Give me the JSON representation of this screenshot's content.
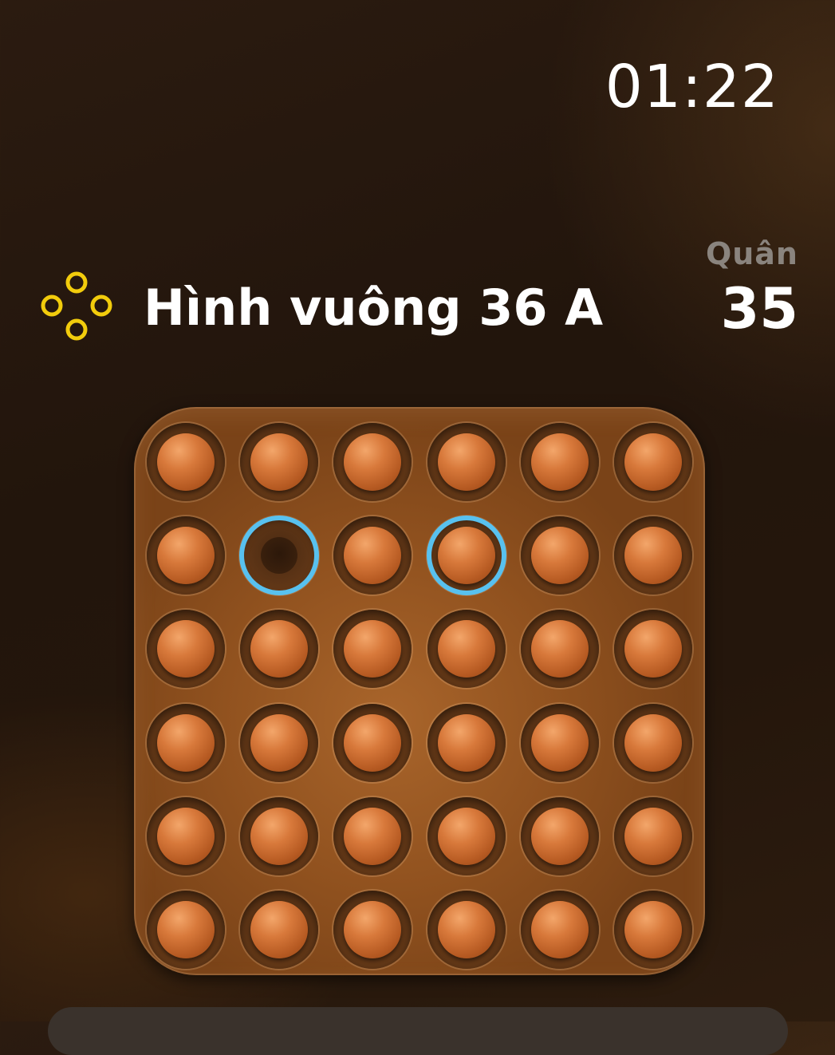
{
  "status": {
    "time": "01:22"
  },
  "puzzle": {
    "title": "Hình vuông 36 A",
    "icon": "four-rings-icon",
    "icon_color": "#f2cc0c"
  },
  "counter": {
    "label": "Quân",
    "value": "35"
  },
  "board": {
    "rows": 6,
    "cols": 6,
    "board_color": "#9c5a24",
    "peg_color": "#d8793b",
    "highlight_color": "#58c1ef",
    "cells": [
      [
        "peg",
        "peg",
        "peg",
        "peg",
        "peg",
        "peg"
      ],
      [
        "peg",
        "empty",
        "peg",
        "peg",
        "peg",
        "peg"
      ],
      [
        "peg",
        "peg",
        "peg",
        "peg",
        "peg",
        "peg"
      ],
      [
        "peg",
        "peg",
        "peg",
        "peg",
        "peg",
        "peg"
      ],
      [
        "peg",
        "peg",
        "peg",
        "peg",
        "peg",
        "peg"
      ],
      [
        "peg",
        "peg",
        "peg",
        "peg",
        "peg",
        "peg"
      ]
    ],
    "highlighted": [
      [
        1,
        1
      ],
      [
        1,
        3
      ]
    ]
  }
}
